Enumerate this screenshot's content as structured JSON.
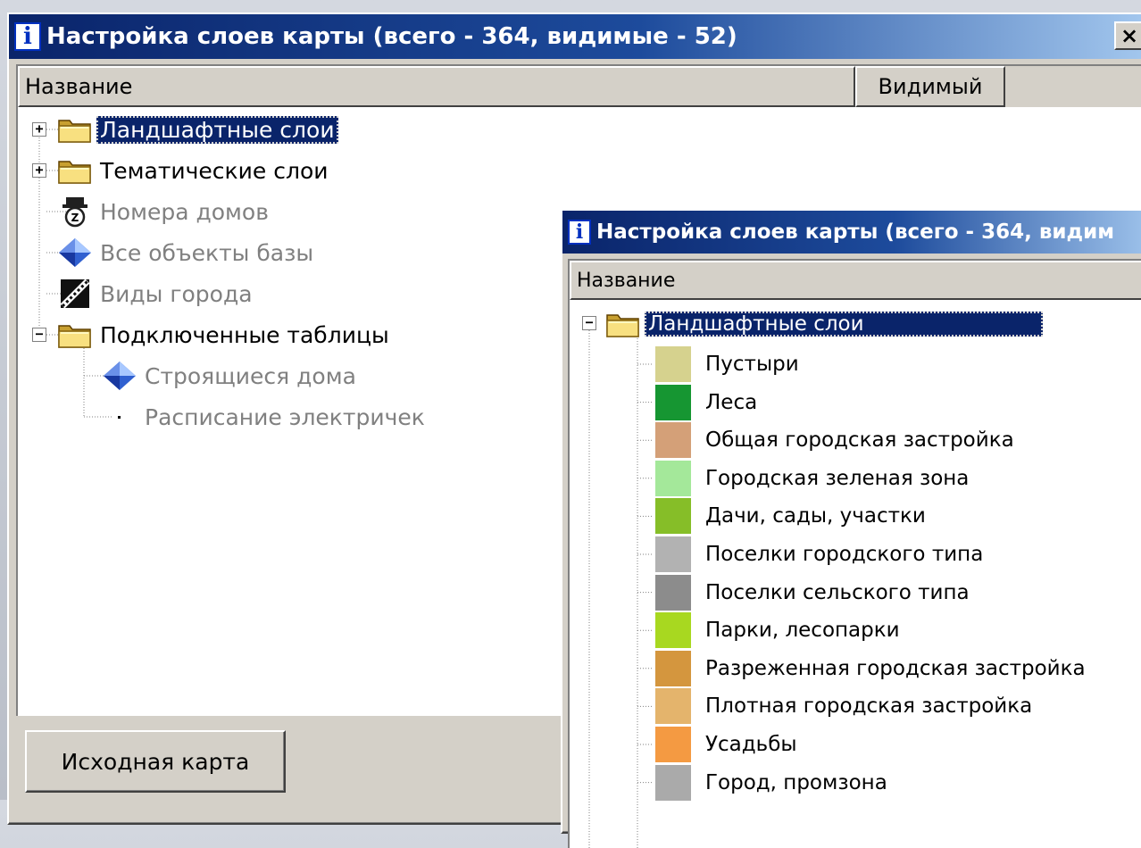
{
  "main_window": {
    "title": "Настройка слоев карты (всего - 364, видимые - 52)",
    "info_icon_glyph": "i",
    "close_glyph": "×",
    "columns": [
      "Название",
      "Видимый"
    ],
    "tree": [
      {
        "label": "Ландшафтные слои",
        "icon": "folder-icon",
        "expander": "+",
        "selected": true,
        "dim": false
      },
      {
        "label": "Тематические слои",
        "icon": "folder-icon",
        "expander": "+",
        "selected": false,
        "dim": false
      },
      {
        "label": "Номера домов",
        "icon": "house-numbers-icon",
        "expander": "",
        "selected": false,
        "dim": true
      },
      {
        "label": "Все объекты базы",
        "icon": "diamond-icon",
        "expander": "",
        "selected": false,
        "dim": true
      },
      {
        "label": "Виды города",
        "icon": "film-strip-icon",
        "expander": "",
        "selected": false,
        "dim": true
      },
      {
        "label": "Подключенные таблицы",
        "icon": "folder-icon",
        "expander": "−",
        "selected": false,
        "dim": false
      },
      {
        "label": "Строящиеся дома",
        "icon": "diamond-icon",
        "expander": "",
        "selected": false,
        "dim": true
      },
      {
        "label": "Расписание электричек",
        "icon": "dot-icon",
        "expander": "",
        "selected": false,
        "dim": true
      }
    ],
    "button_label": "Исходная карта"
  },
  "sub_window": {
    "title": "Настройка слоев карты (всего - 364, видим",
    "info_icon_glyph": "i",
    "column": "Название",
    "root": {
      "label": "Ландшафтные слои",
      "expander": "−",
      "selected": true
    },
    "layers": [
      {
        "label": "Пустыри",
        "color": "#d6d28e"
      },
      {
        "label": "Леса",
        "color": "#169632"
      },
      {
        "label": "Общая городская застройка",
        "color": "#d4a078"
      },
      {
        "label": "Городская зеленая зона",
        "color": "#a4e89a"
      },
      {
        "label": "Дачи, сады, участки",
        "color": "#86be28"
      },
      {
        "label": "Поселки городского типа",
        "color": "#b2b2b2"
      },
      {
        "label": "Поселки сельского типа",
        "color": "#8c8c8c"
      },
      {
        "label": "Парки, лесопарки",
        "color": "#a8d820"
      },
      {
        "label": "Разреженная городская застройка",
        "color": "#d4963e"
      },
      {
        "label": "Плотная городская застройка",
        "color": "#e4b46c"
      },
      {
        "label": "Усадьбы",
        "color": "#f49a42"
      },
      {
        "label": "Город, промзона",
        "color": "#aaaaaa"
      }
    ]
  }
}
